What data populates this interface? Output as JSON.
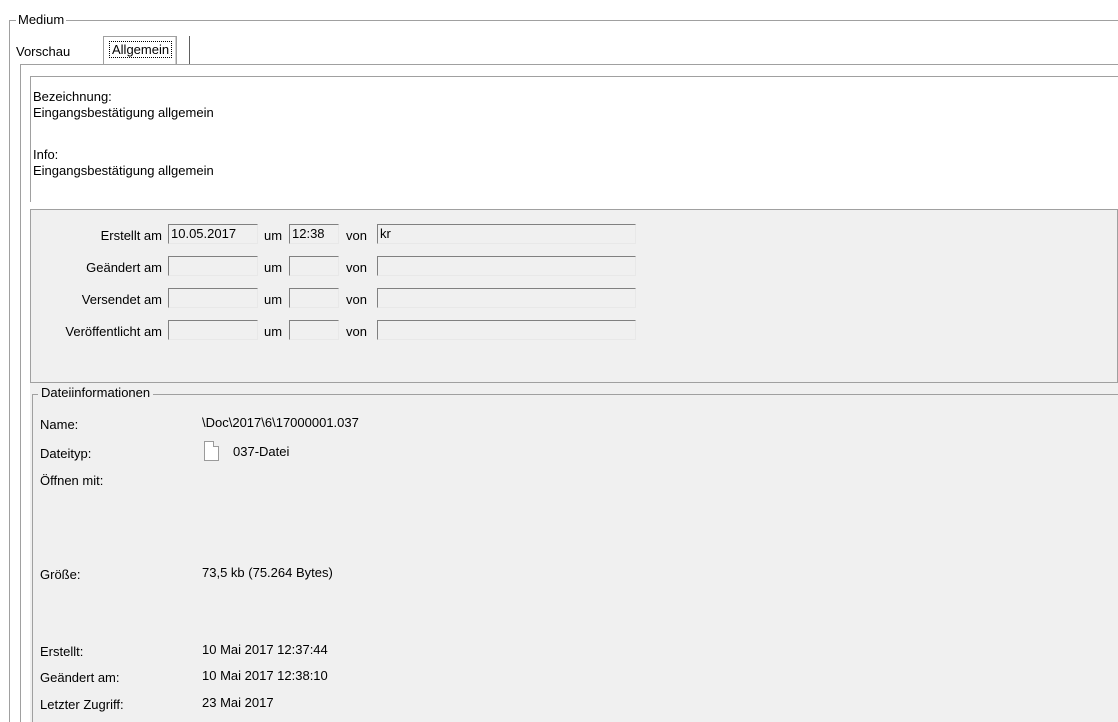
{
  "medium": {
    "legend": "Medium"
  },
  "tabs": [
    {
      "label": "Vorschau",
      "active": false
    },
    {
      "label": "Allgemein",
      "active": true
    }
  ],
  "info": {
    "bezeichnung_label": "Bezeichnung:",
    "bezeichnung_value": "Eingangsbestätigung allgemein",
    "info_label": "Info:",
    "info_value": "Eingangsbestätigung allgemein"
  },
  "dates": {
    "um_label": "um",
    "von_label": "von",
    "rows": [
      {
        "label": "Erstellt am",
        "date": "10.05.2017",
        "time": "12:38",
        "user": "kr"
      },
      {
        "label": "Geändert am",
        "date": "",
        "time": "",
        "user": ""
      },
      {
        "label": "Versendet am",
        "date": "",
        "time": "",
        "user": ""
      },
      {
        "label": "Veröffentlicht am",
        "date": "",
        "time": "",
        "user": ""
      }
    ]
  },
  "file_info": {
    "legend": "Dateiinformationen",
    "name_label": "Name:",
    "name_value": "\\Doc\\2017\\6\\17000001.037",
    "type_label": "Dateityp:",
    "type_value": "037-Datei",
    "type_icon": "document-icon",
    "open_with_label": "Öffnen mit:",
    "open_with_value": "",
    "size_label": "Größe:",
    "size_value": "73,5 kb (75.264 Bytes)",
    "created_label": "Erstellt:",
    "created_value": "10 Mai 2017 12:37:44",
    "modified_label": "Geändert am:",
    "modified_value": "10 Mai 2017 12:38:10",
    "accessed_label": "Letzter Zugriff:",
    "accessed_value": "23 Mai 2017"
  }
}
